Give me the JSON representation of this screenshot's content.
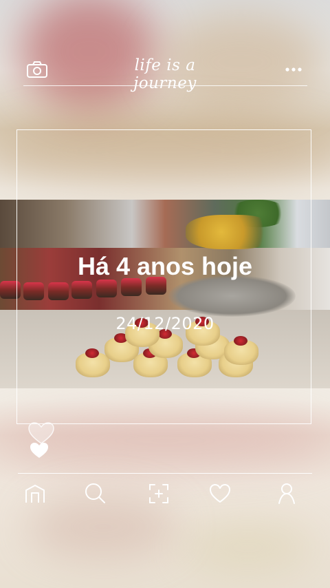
{
  "header": {
    "title": "life is a journey",
    "left_icon": "camera-icon",
    "right_icon": "more-horizontal-icon"
  },
  "memory": {
    "title": "Há 4 anos hoje",
    "date": "24/12/2020"
  },
  "likes": {
    "icons": [
      "heart-outline-icon",
      "heart-filled-icon"
    ]
  },
  "nav": {
    "items": [
      "home-icon",
      "search-icon",
      "add-photo-icon",
      "favorites-icon",
      "profile-icon"
    ]
  },
  "colors": {
    "foreground": "#ffffff"
  }
}
